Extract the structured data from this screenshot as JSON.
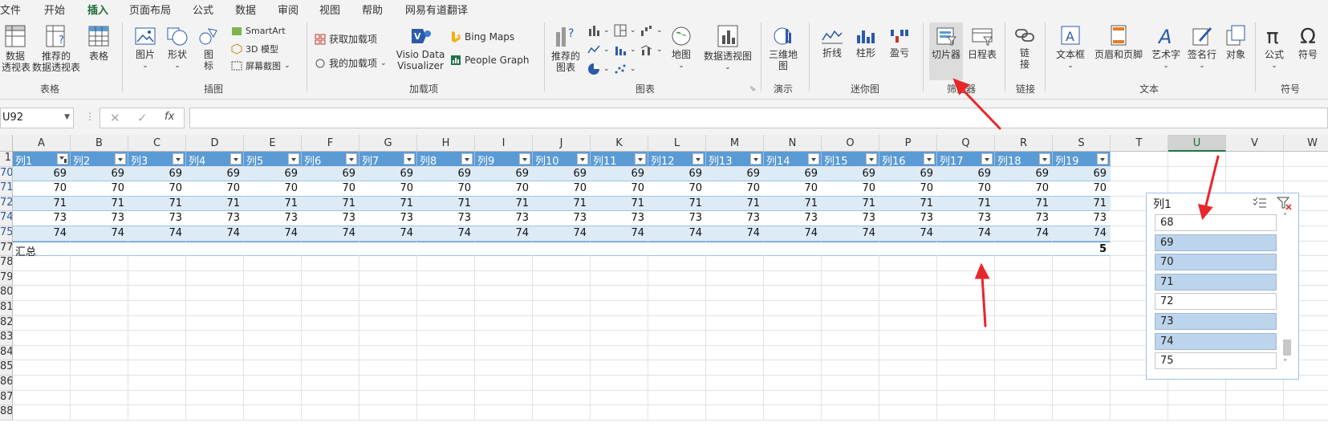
{
  "tabs": [
    "文件",
    "开始",
    "插入",
    "页面布局",
    "公式",
    "数据",
    "审阅",
    "视图",
    "帮助",
    "网易有道翻译"
  ],
  "active_tab": "插入",
  "ribbon": {
    "tables": {
      "group": "表格",
      "pivot_l1": "数据",
      "pivot_l2": "透视表",
      "rec_pivot_l1": "推荐的",
      "rec_pivot_l2": "数据透视表",
      "table": "表格"
    },
    "illustrations": {
      "group": "插图",
      "picture": "图片",
      "shapes": "形状",
      "icons_l1": "图",
      "icons_l2": "标",
      "smartart": "SmartArt",
      "model3d": "3D 模型",
      "screenshot": "屏幕截图"
    },
    "addins": {
      "group": "加载项",
      "get": "获取加载项",
      "my": "我的加载项",
      "visio_l1": "Visio Data",
      "visio_l2": "Visualizer",
      "bing": "Bing Maps",
      "people": "People Graph"
    },
    "charts": {
      "group": "图表",
      "rec_l1": "推荐的",
      "rec_l2": "图表",
      "map": "地图",
      "pivotchart": "数据透视图"
    },
    "tours": {
      "group": "演示",
      "map3d_l1": "三维地",
      "map3d_l2": "图"
    },
    "sparklines": {
      "group": "迷你图",
      "line": "折线",
      "column": "柱形",
      "winloss": "盈亏"
    },
    "filters": {
      "group": "筛选器",
      "slicer": "切片器",
      "timeline": "日程表"
    },
    "links": {
      "group": "链接",
      "link_l1": "链",
      "link_l2": "接"
    },
    "text": {
      "group": "文本",
      "textbox": "文本框",
      "headerfooter": "页眉和页脚",
      "wordart": "艺术字",
      "signature": "签名行",
      "object": "对象"
    },
    "symbols": {
      "group": "符号",
      "equation": "公式",
      "symbol": "符号"
    }
  },
  "formula_bar": {
    "name_box": "U92",
    "fx": "fx",
    "value": ""
  },
  "columns": [
    "A",
    "B",
    "C",
    "D",
    "E",
    "F",
    "G",
    "H",
    "I",
    "J",
    "K",
    "L",
    "M",
    "N",
    "O",
    "P",
    "Q",
    "R",
    "S",
    "T",
    "U",
    "V",
    "W"
  ],
  "selected_column": "U",
  "row_numbers": [
    "1",
    "70",
    "71",
    "72",
    "74",
    "75",
    "77",
    "78",
    "79",
    "80",
    "81",
    "82",
    "83",
    "84",
    "85",
    "86",
    "87",
    "88"
  ],
  "table": {
    "headers": [
      "列1",
      "列2",
      "列3",
      "列4",
      "列5",
      "列6",
      "列7",
      "列8",
      "列9",
      "列10",
      "列11",
      "列12",
      "列13",
      "列14",
      "列15",
      "列16",
      "列17",
      "列18",
      "列19"
    ],
    "rows": [
      {
        "row": "70",
        "value": "69"
      },
      {
        "row": "71",
        "value": "70"
      },
      {
        "row": "72",
        "value": "71"
      },
      {
        "row": "74",
        "value": "73"
      },
      {
        "row": "75",
        "value": "74"
      }
    ],
    "total_label": "汇总",
    "total_value": "5"
  },
  "slicer": {
    "title": "列1",
    "items": [
      {
        "label": "68",
        "selected": false
      },
      {
        "label": "69",
        "selected": true
      },
      {
        "label": "70",
        "selected": true
      },
      {
        "label": "71",
        "selected": true
      },
      {
        "label": "72",
        "selected": false
      },
      {
        "label": "73",
        "selected": true
      },
      {
        "label": "74",
        "selected": true
      },
      {
        "label": "75",
        "selected": false
      }
    ]
  },
  "colors": {
    "accent": "#217346",
    "table_header": "#5b9bd5",
    "band": "#ddebf7",
    "slicer_selected": "#bcd4ec",
    "annotation_arrow": "#e8262b"
  }
}
